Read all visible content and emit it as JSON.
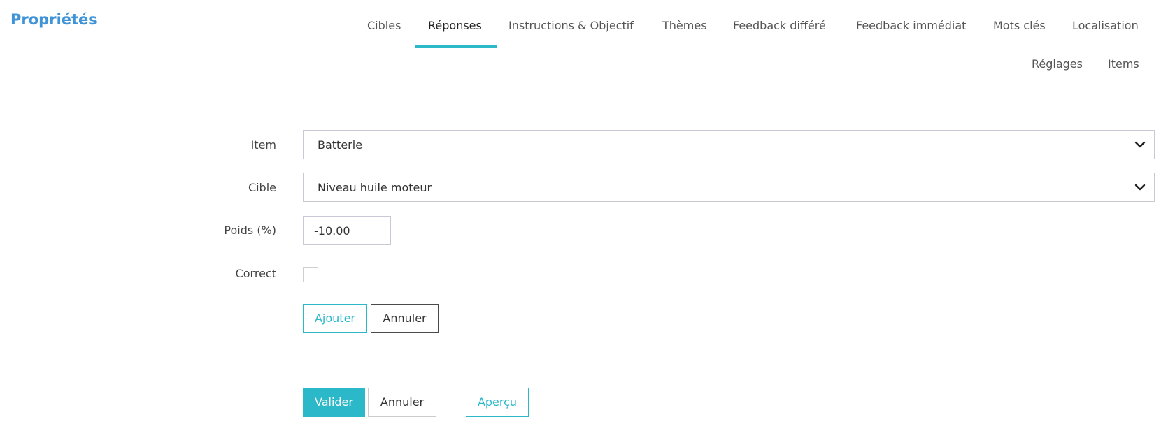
{
  "header": {
    "title": "Propriétés"
  },
  "tabs": [
    {
      "label": "Cibles",
      "active": false
    },
    {
      "label": "Réponses",
      "active": true
    },
    {
      "label": "Instructions & Objectif",
      "active": false
    },
    {
      "label": "Thèmes",
      "active": false
    },
    {
      "label": "Feedback différé",
      "active": false
    },
    {
      "label": "Feedback immédiat",
      "active": false
    },
    {
      "label": "Mots clés",
      "active": false
    },
    {
      "label": "Localisation",
      "active": false
    },
    {
      "label": "Réglages",
      "active": false
    },
    {
      "label": "Items",
      "active": false
    }
  ],
  "form": {
    "item": {
      "label": "Item",
      "value": "Batterie"
    },
    "cible": {
      "label": "Cible",
      "value": "Niveau huile moteur"
    },
    "poids": {
      "label": "Poids (%)",
      "value": "-10.00"
    },
    "correct": {
      "label": "Correct",
      "checked": false
    },
    "add_label": "Ajouter",
    "cancel_label": "Annuler"
  },
  "footer": {
    "validate_label": "Valider",
    "cancel_label": "Annuler",
    "preview_label": "Aperçu"
  },
  "colors": {
    "accent": "#2bb8c9",
    "title": "#3f93d6",
    "border": "#c9c9d6"
  },
  "icons": {
    "select_arrow": "chevron-down-icon"
  }
}
